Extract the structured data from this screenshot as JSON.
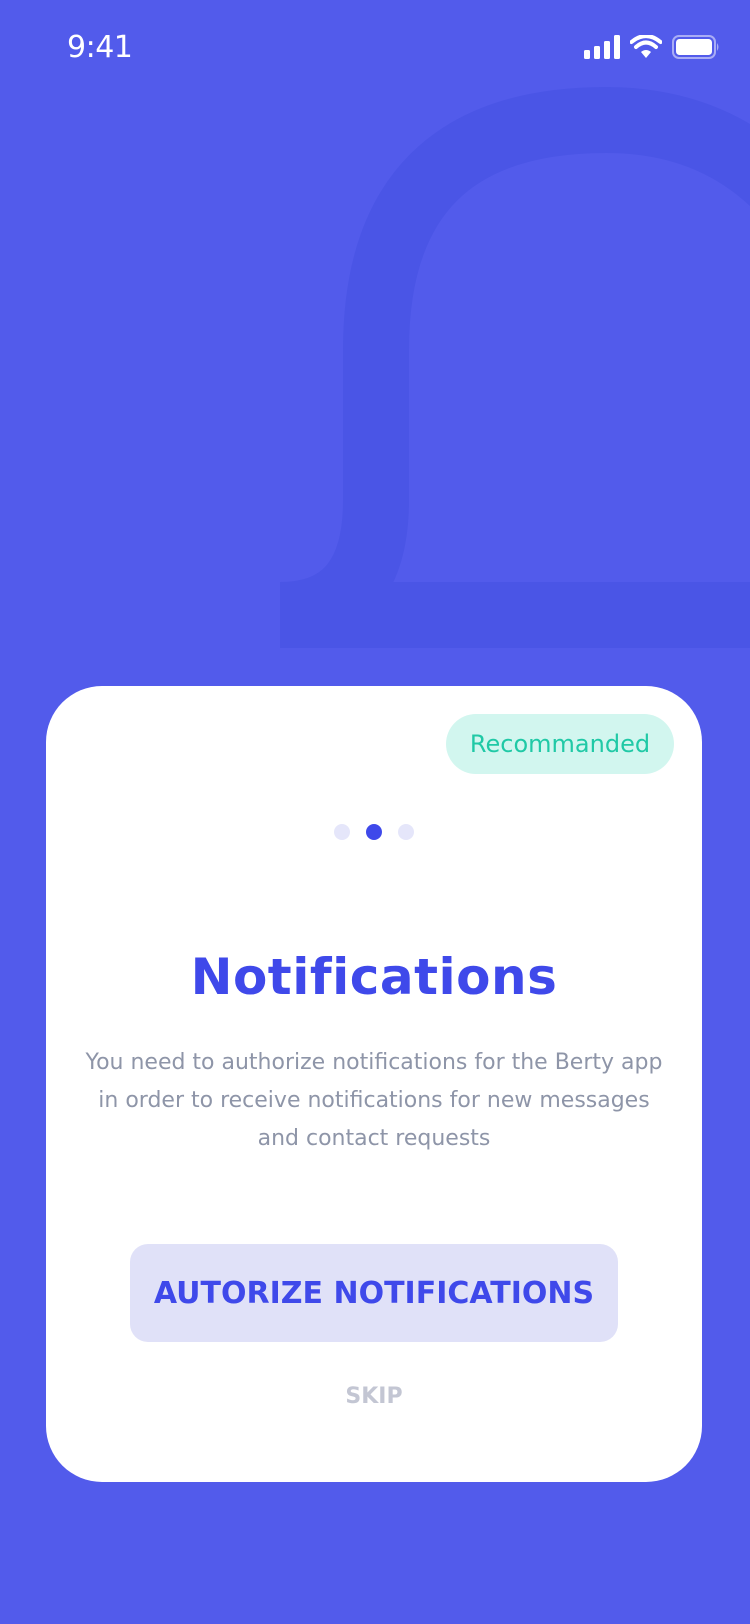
{
  "status_bar": {
    "time": "9:41",
    "icons": [
      "cellular-signal-icon",
      "wifi-icon",
      "battery-icon"
    ]
  },
  "background": {
    "icon": "bell-icon",
    "color": "#525BEB",
    "shape_color": "#4A55E6"
  },
  "card": {
    "badge": "Recommanded",
    "pagination": {
      "total": 3,
      "active": 2
    },
    "title": "Notifications",
    "description": "You need to authorize notifications for the Berty app in order to receive notifications for new messages and contact requests",
    "primary_button": "AUTORIZE NOTIFICATIONS",
    "skip": "SKIP"
  },
  "colors": {
    "accent": "#3F49EA",
    "badge_text": "#20C9A6",
    "badge_bg": "#D2F6EF",
    "button_bg": "#E0E1F8",
    "muted_text": "#8E95A8",
    "skip_text": "#C3C6D3"
  }
}
